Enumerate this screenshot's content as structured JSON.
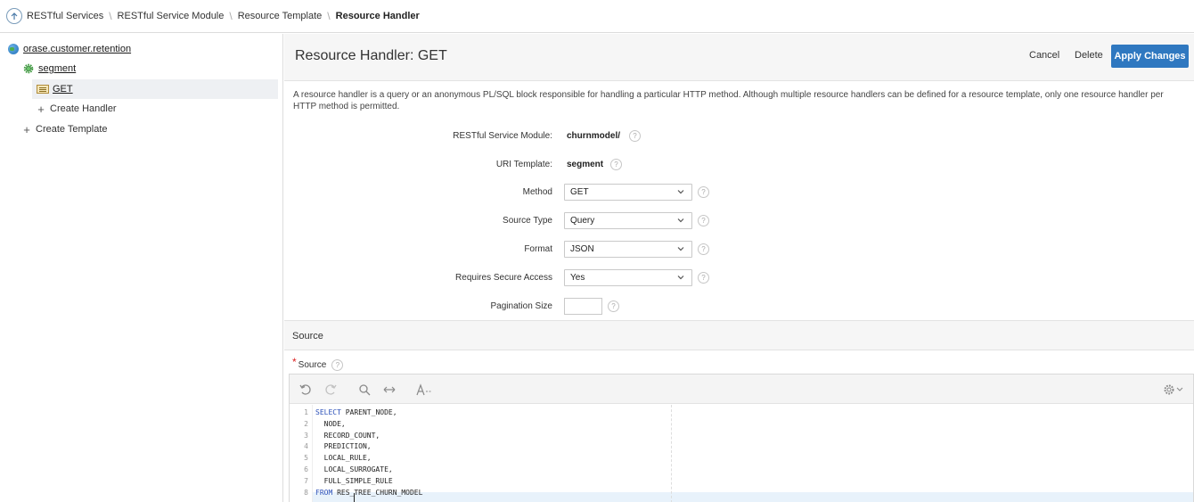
{
  "breadcrumb": {
    "items": [
      "RESTful Services",
      "RESTful Service Module",
      "Resource Template"
    ],
    "current": "Resource Handler"
  },
  "tree": {
    "root": "orase.customer.retention",
    "template": "segment",
    "handler": "GET",
    "create_handler": "Create Handler",
    "create_template": "Create Template"
  },
  "header": {
    "title": "Resource Handler: GET",
    "cancel_label": "Cancel",
    "delete_label": "Delete",
    "apply_label": "Apply Changes"
  },
  "description": "A resource handler is a query or an anonymous PL/SQL block responsible for handling a particular HTTP method. Although multiple resource handlers can be defined for a resource template, only one resource handler per HTTP method is permitted.",
  "form": {
    "module_label": "RESTful Service Module:",
    "module_value": "churnmodel/",
    "uri_label": "URI Template:",
    "uri_value": "segment",
    "method_label": "Method",
    "method_value": "GET",
    "source_type_label": "Source Type",
    "source_type_value": "Query",
    "format_label": "Format",
    "format_value": "JSON",
    "secure_label": "Requires Secure Access",
    "secure_value": "Yes",
    "pagination_label": "Pagination Size",
    "pagination_value": ""
  },
  "source_section": {
    "title": "Source",
    "field_label": "Source"
  },
  "help_glyph": "?",
  "required_glyph": "*",
  "code": {
    "line_numbers": [
      "1",
      "2",
      "3",
      "4",
      "5",
      "6",
      "7",
      "8"
    ],
    "l1_kw": "SELECT",
    "l1_rest": " PARENT_NODE,",
    "l2": "  NODE,",
    "l3": "  RECORD_COUNT,",
    "l4": "  PREDICTION,",
    "l5": "  LOCAL_RULE,",
    "l6": "  LOCAL_SURROGATE,",
    "l7": "  FULL_SIMPLE_RULE",
    "l8_kw": "FROM",
    "l8_rest": " RES_TREE_CHURN_MODEL"
  }
}
